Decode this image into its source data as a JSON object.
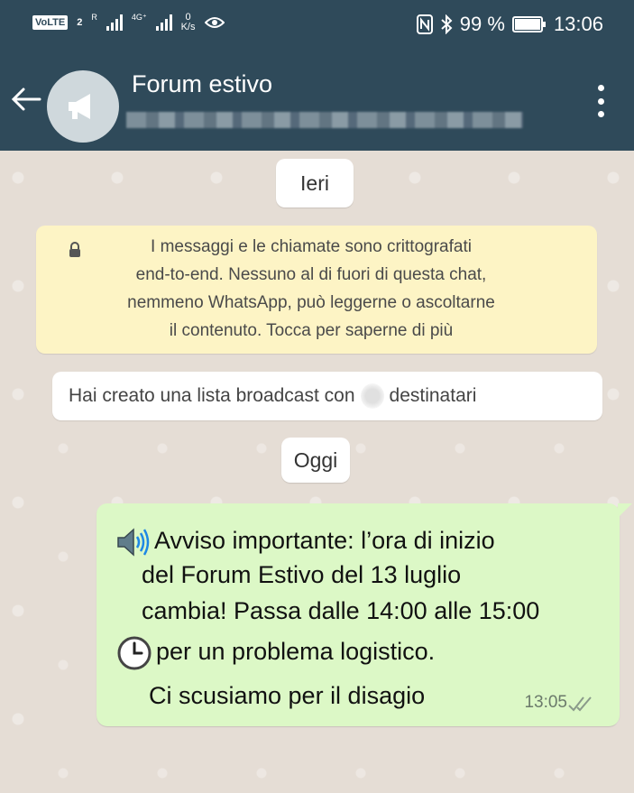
{
  "status_bar": {
    "volte": "VoLTE",
    "sim": "2",
    "sig1_label": "R",
    "sig2_label": "4G⁺",
    "speed_value": "0",
    "speed_unit": "K/s",
    "battery": "99 %",
    "clock": "13:06"
  },
  "header": {
    "title": "Forum estivo",
    "subtitle": "",
    "icons": [
      "back-arrow-icon",
      "broadcast-megaphone-icon",
      "more-vert-icon"
    ]
  },
  "chat": {
    "date_yesterday": "Ieri",
    "e2e_notice": {
      "line1": "I messaggi e le chiamate sono crittografati",
      "line2": "end-to-end. Nessuno al di fuori di questa chat,",
      "line3": "nemmeno WhatsApp, può leggerne o ascoltarne",
      "line4": "il contenuto. Tocca per saperne di più"
    },
    "broadcast_notice": {
      "before": "Hai creato una lista broadcast con",
      "after": "destinatari"
    },
    "date_today": "Oggi",
    "message": {
      "line1": "Avviso importante: l’ora di inizio",
      "line2": "del Forum Estivo del 13 luglio",
      "line3": "cambia! Passa dalle 14:00 alle 15:00",
      "line4": "per un problema logistico.",
      "line5": "Ci scusiamo per il disagio",
      "time": "13:05",
      "status": "read"
    }
  },
  "colors": {
    "header_bg": "#2f4a5a",
    "chat_bg": "#e5ddd5",
    "outgoing_bubble": "#dcf8c6",
    "e2e_bg": "#fdf4c5"
  }
}
